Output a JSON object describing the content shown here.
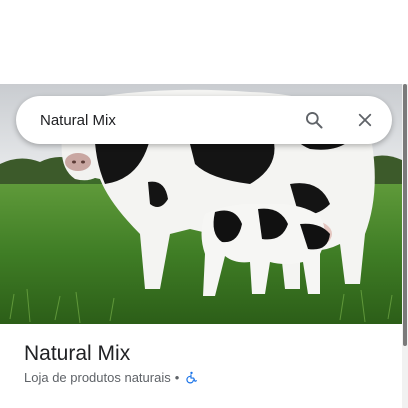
{
  "search": {
    "value": "Natural Mix",
    "search_icon": "search-icon",
    "clear_icon": "close-icon"
  },
  "place": {
    "name": "Natural Mix",
    "category": "Loja de produtos naturais",
    "separator": "•",
    "accessibility_icon": "wheelchair-icon"
  },
  "photo": {
    "description_icon": "hero-photo"
  },
  "colors": {
    "accessibility_blue": "#1a73e8",
    "title_text": "#202124",
    "secondary_text": "#5f6368",
    "icon_gray": "#5f6368"
  }
}
